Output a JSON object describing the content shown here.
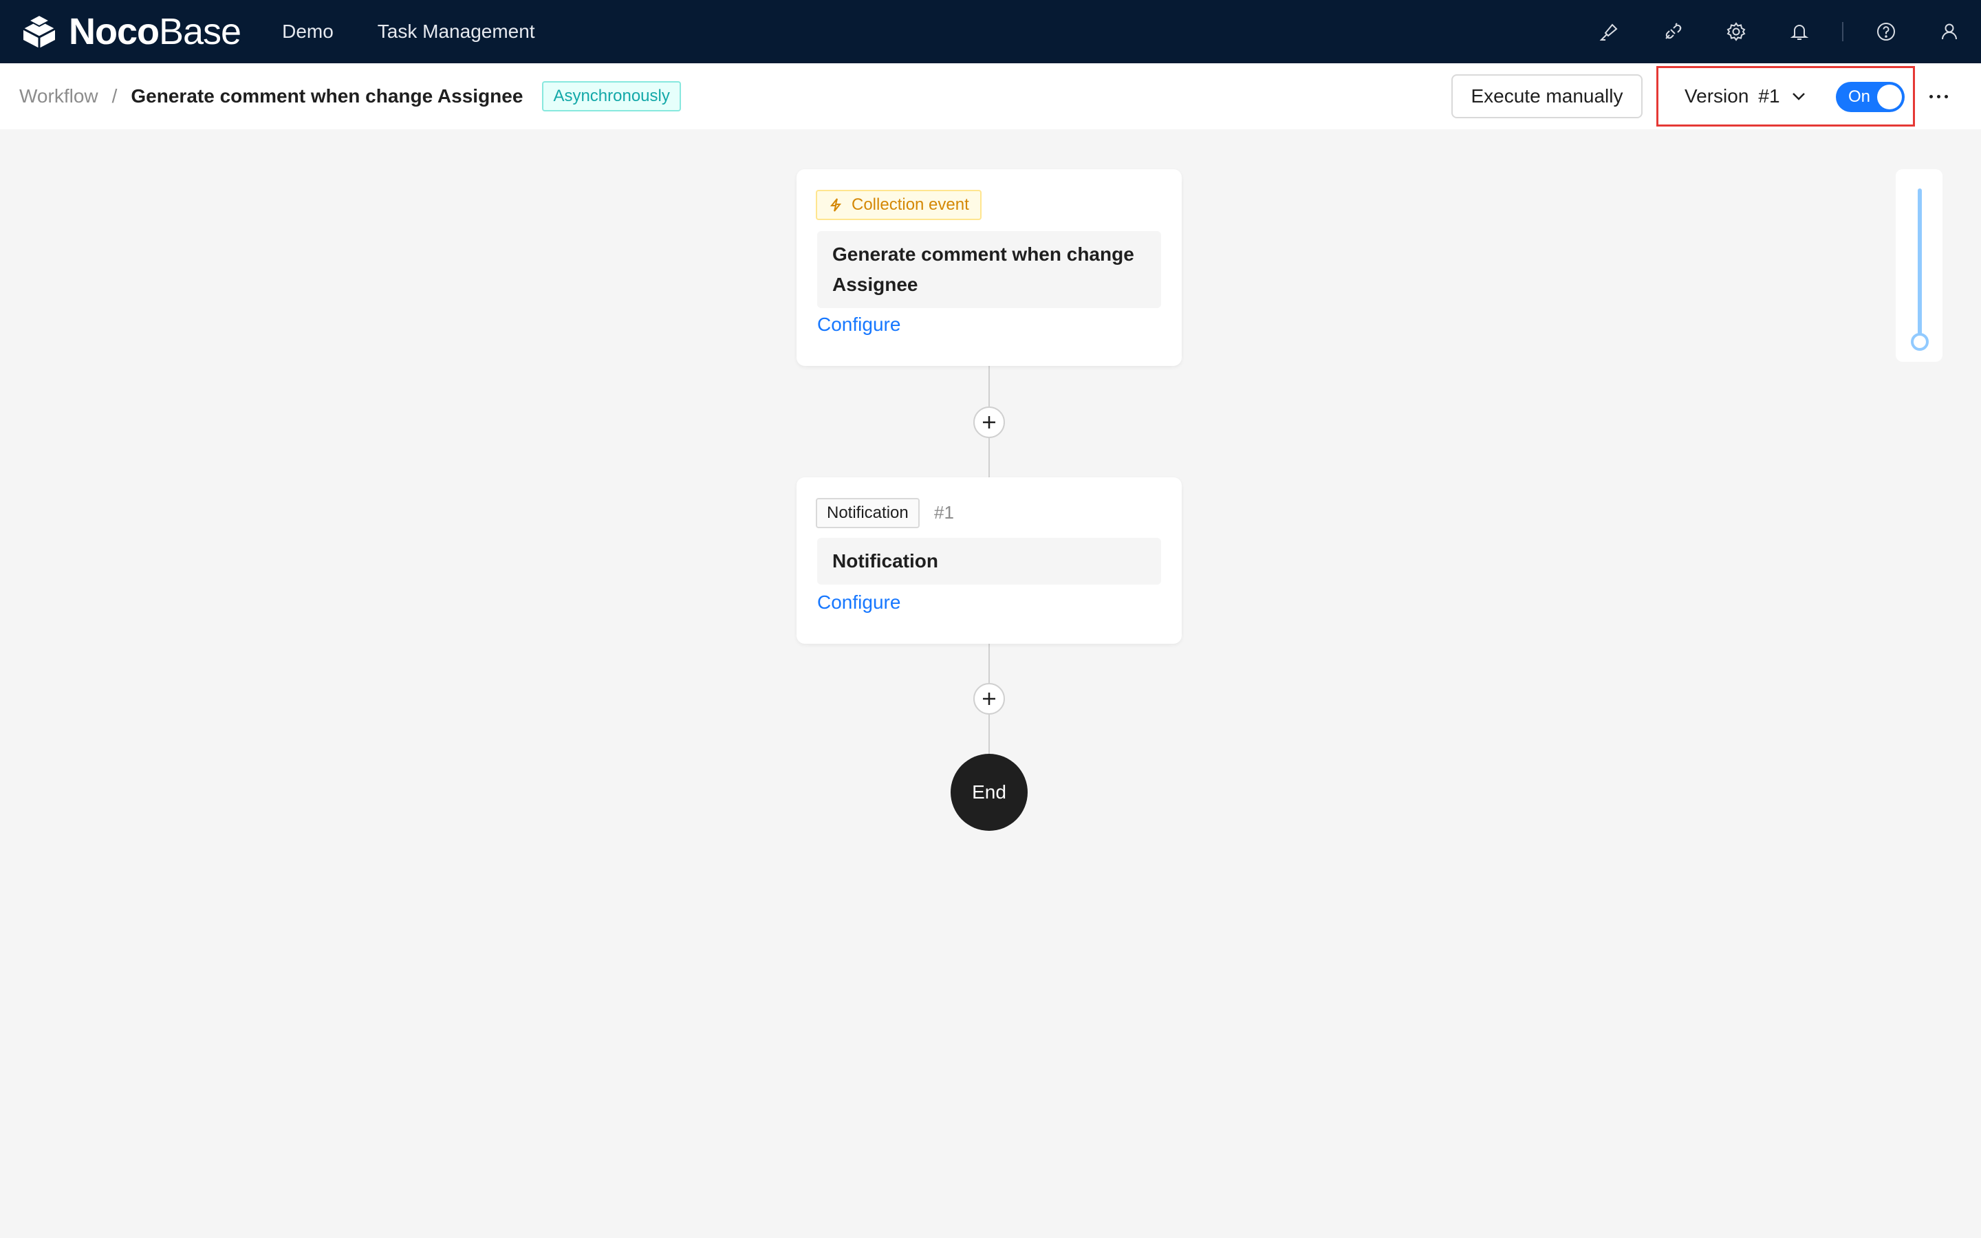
{
  "brand": {
    "name_bold": "Noco",
    "name_light": "Base"
  },
  "topnav": {
    "items": [
      "Demo",
      "Task Management"
    ]
  },
  "top_actions": {
    "icons": [
      "brush-icon",
      "plugin-icon",
      "gear-icon",
      "bell-icon",
      "help-icon",
      "user-icon"
    ]
  },
  "breadcrumb": {
    "root": "Workflow",
    "separator": "/",
    "current": "Generate comment when change Assignee"
  },
  "mode_tag": "Asynchronously",
  "actions": {
    "execute_label": "Execute manually",
    "version_label": "Version",
    "version_number": "#1",
    "toggle_label": "On"
  },
  "trigger_node": {
    "tag": "Collection event",
    "title": "Generate comment when change Assignee",
    "configure": "Configure"
  },
  "notification_node": {
    "tag": "Notification",
    "id": "#1",
    "title": "Notification",
    "configure": "Configure"
  },
  "end_node": {
    "label": "End"
  },
  "colors": {
    "topbar": "#061a33",
    "primary": "#1677ff",
    "highlight_border": "#e53935"
  }
}
